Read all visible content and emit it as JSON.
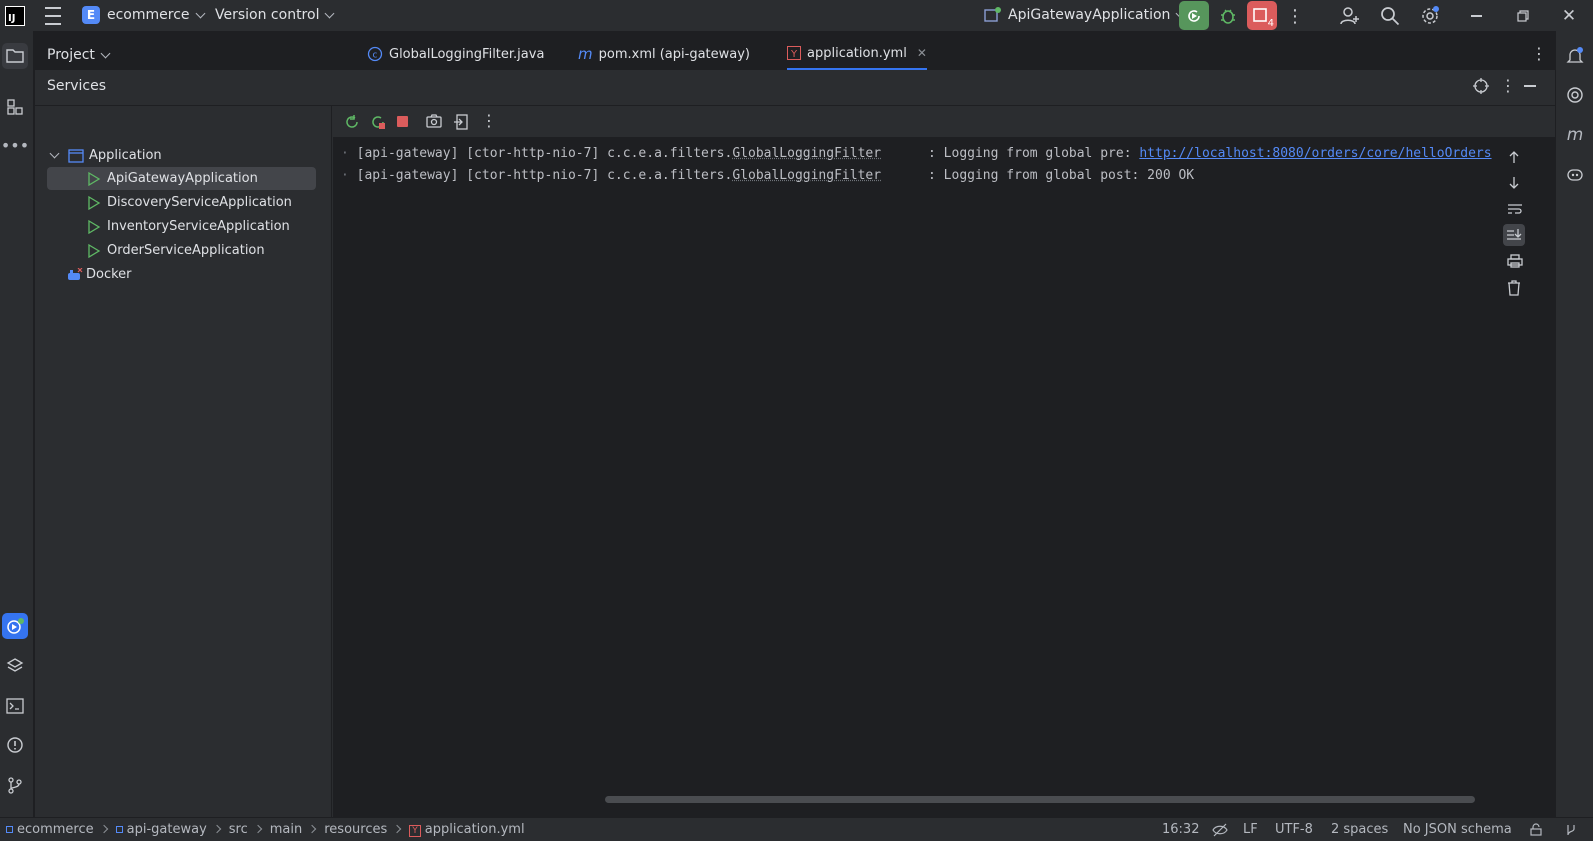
{
  "titlebar": {
    "project_badge": "E",
    "project_name": "ecommerce",
    "vcs_label": "Version control",
    "run_config": "ApiGatewayApplication",
    "stop_count": "4"
  },
  "tool_window": {
    "project_label": "Project",
    "services_title": "Services"
  },
  "tabs": [
    {
      "label": "GlobalLoggingFilter.java",
      "icon": "java-class-icon"
    },
    {
      "label": "pom.xml (api-gateway)",
      "icon": "maven-icon"
    },
    {
      "label": "application.yml",
      "icon": "yaml-icon",
      "active": true
    }
  ],
  "tree": {
    "root": "Application",
    "items": [
      "ApiGatewayApplication",
      "DiscoveryServiceApplication",
      "InventoryServiceApplication",
      "OrderServiceApplication"
    ],
    "docker": "Docker"
  },
  "console": {
    "lines": [
      {
        "prefix": "[api-gateway] [ctor-http-nio-7] c.c.e.a.filters.",
        "cls": "GlobalLoggingFilter",
        "msg": "      : Logging from global pre: ",
        "link": "http://localhost:8080/orders/core/helloOrders"
      },
      {
        "prefix": "[api-gateway] [ctor-http-nio-7] c.c.e.a.filters.",
        "cls": "GlobalLoggingFilter",
        "msg": "      : Logging from global post: 200 OK",
        "link": ""
      }
    ]
  },
  "statusbar": {
    "crumbs": [
      "ecommerce",
      "api-gateway",
      "src",
      "main",
      "resources",
      "application.yml"
    ],
    "position": "16:32",
    "line_sep": "LF",
    "encoding": "UTF-8",
    "indent": "2 spaces",
    "schema": "No JSON schema"
  },
  "colors": {
    "accent": "#3574f0",
    "run_green": "#57965c",
    "stop_red": "#db5c5c"
  }
}
